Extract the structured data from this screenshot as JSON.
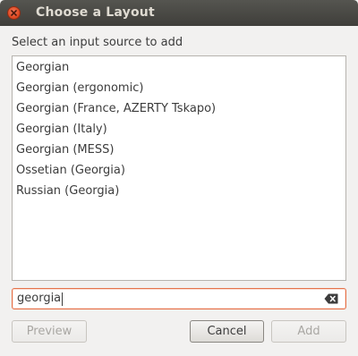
{
  "window": {
    "title": "Choose a Layout"
  },
  "prompt": "Select an input source to add",
  "layouts": [
    "Georgian",
    "Georgian (ergonomic)",
    "Georgian (France, AZERTY Tskapo)",
    "Georgian (Italy)",
    "Georgian (MESS)",
    "Ossetian (Georgia)",
    "Russian (Georgia)"
  ],
  "search": {
    "value": "georgia",
    "clear_icon": "backspace-clear-icon"
  },
  "buttons": {
    "preview": "Preview",
    "cancel": "Cancel",
    "add": "Add"
  },
  "colors": {
    "titlebar": "#3f3e3a",
    "close": "#df4a23",
    "focus_border": "#e6734b"
  }
}
